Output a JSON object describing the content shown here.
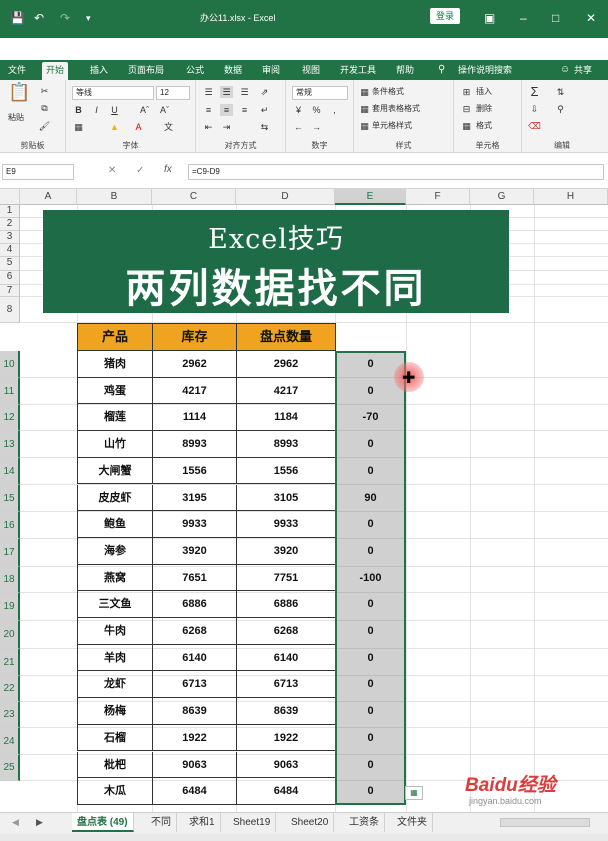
{
  "title": {
    "filename": "办公11.xlsx  -  Excel",
    "login": "登录",
    "share": "共享",
    "search": "操作说明搜索"
  },
  "tabs": [
    "文件",
    "开始",
    "插入",
    "页面布局",
    "公式",
    "数据",
    "审阅",
    "视图",
    "开发工具",
    "帮助"
  ],
  "ribbon": {
    "clipboard_label": "剪贴板",
    "paste": "粘贴",
    "font_label": "字体",
    "font_name": "等线",
    "font_size": "12",
    "align_label": "对齐方式",
    "number_label": "数字",
    "number_format": "常规",
    "styles_label": "样式",
    "cond_format": "条件格式",
    "table_format": "套用表格格式",
    "cell_style": "单元格样式",
    "cells_label": "单元格",
    "insert": "插入",
    "delete": "删除",
    "format": "格式",
    "edit_label": "编辑"
  },
  "formula_bar": {
    "cell_ref": "E9",
    "formula": "=C9-D9"
  },
  "columns": [
    "A",
    "B",
    "C",
    "D",
    "E",
    "F",
    "G",
    "H"
  ],
  "rows": [
    "1",
    "2",
    "3",
    "4",
    "5",
    "6",
    "7",
    "8",
    "9",
    "10",
    "11",
    "12",
    "13",
    "14",
    "15",
    "16",
    "17",
    "18",
    "19",
    "20",
    "21",
    "22",
    "23",
    "24",
    "25"
  ],
  "banner": {
    "line1": "Excel技巧",
    "line2": "两列数据找不同"
  },
  "table": {
    "headers": [
      "产品",
      "库存",
      "盘点数量"
    ],
    "rows": [
      [
        "猪肉",
        "2962",
        "2962",
        "0"
      ],
      [
        "鸡蛋",
        "4217",
        "4217",
        "0"
      ],
      [
        "榴莲",
        "1114",
        "1184",
        "-70"
      ],
      [
        "山竹",
        "8993",
        "8993",
        "0"
      ],
      [
        "大闸蟹",
        "1556",
        "1556",
        "0"
      ],
      [
        "皮皮虾",
        "3195",
        "3105",
        "90"
      ],
      [
        "鲍鱼",
        "9933",
        "9933",
        "0"
      ],
      [
        "海参",
        "3920",
        "3920",
        "0"
      ],
      [
        "燕窝",
        "7651",
        "7751",
        "-100"
      ],
      [
        "三文鱼",
        "6886",
        "6886",
        "0"
      ],
      [
        "牛肉",
        "6268",
        "6268",
        "0"
      ],
      [
        "羊肉",
        "6140",
        "6140",
        "0"
      ],
      [
        "龙虾",
        "6713",
        "6713",
        "0"
      ],
      [
        "杨梅",
        "8639",
        "8639",
        "0"
      ],
      [
        "石榴",
        "1922",
        "1922",
        "0"
      ],
      [
        "枇杷",
        "9063",
        "9063",
        "0"
      ],
      [
        "木瓜",
        "6484",
        "6484",
        "0"
      ]
    ]
  },
  "sheets": [
    "盘点表 (49)",
    "不同",
    "求和1",
    "Sheet19",
    "Sheet20",
    "工资条",
    "文件夹"
  ],
  "watermark": {
    "brand": "Baidu经验",
    "url": "jingyan.baidu.com"
  },
  "colors": {
    "excel_green": "#217346",
    "banner_bg": "#1e6b48",
    "header_fill": "#f0a31f"
  }
}
